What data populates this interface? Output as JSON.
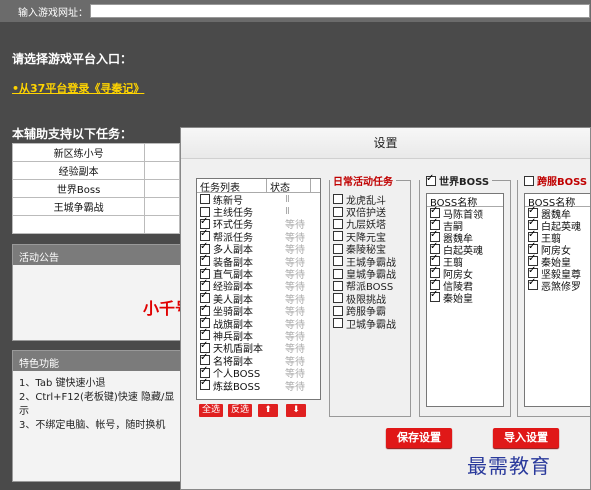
{
  "urlbar": {
    "label": "输入游戏网址：",
    "value": ""
  },
  "main": {
    "choose_title": "请选择游戏平台入口：",
    "platform_link": "•从37平台登录《寻秦记》",
    "support_title": "本辅助支持以下任务：",
    "support_rows": [
      "新区练小号",
      "经验副本",
      "世界Boss",
      "王城争霸战",
      ""
    ]
  },
  "notice": {
    "header": "活动公告",
    "red_text": "小千号"
  },
  "feature": {
    "header": "特色功能",
    "items": [
      "1、Tab 键快速小退",
      "2、Ctrl+F12(老板键)快速 隐藏/显示",
      "3、不绑定电脑、帐号，随时换机"
    ]
  },
  "dialog": {
    "title": "设置",
    "task_list": {
      "col_name": "任务列表",
      "col_status": "状态",
      "rows": [
        {
          "name": "练新号",
          "status": "Ⅱ",
          "checked": false
        },
        {
          "name": "主线任务",
          "status": "Ⅱ",
          "checked": false
        },
        {
          "name": "环式任务",
          "status": "等待",
          "checked": true
        },
        {
          "name": "帮派任务",
          "status": "等待",
          "checked": true
        },
        {
          "name": "多人副本",
          "status": "等待",
          "checked": true
        },
        {
          "name": "装备副本",
          "status": "等待",
          "checked": true
        },
        {
          "name": "直气副本",
          "status": "等待",
          "checked": true
        },
        {
          "name": "经验副本",
          "status": "等待",
          "checked": true
        },
        {
          "name": "美人副本",
          "status": "等待",
          "checked": true
        },
        {
          "name": "坐骑副本",
          "status": "等待",
          "checked": true
        },
        {
          "name": "战旗副本",
          "status": "等待",
          "checked": true
        },
        {
          "name": "神兵副本",
          "status": "等待",
          "checked": true
        },
        {
          "name": "天机盾副本",
          "status": "等待",
          "checked": true
        },
        {
          "name": "名将副本",
          "status": "等待",
          "checked": true
        },
        {
          "name": "个人BOSS",
          "status": "等待",
          "checked": true
        },
        {
          "name": "炼兹BOSS",
          "status": "等待",
          "checked": true
        }
      ]
    },
    "buttons": {
      "select_all": "全选",
      "invert": "反选",
      "up": "⬆",
      "down": "⬇",
      "save": "保存设置",
      "import": "导入设置"
    },
    "daily": {
      "title": "日常活动任务",
      "items": [
        "龙虎乱斗",
        "双倍护送",
        "九层妖塔",
        "天降元宝",
        "秦陵秘宝",
        "王城争霸战",
        "皇城争霸战",
        "帮派BOSS",
        "极限挑战",
        "跨服争霸",
        "卫城争霸战"
      ]
    },
    "world": {
      "title": "世界BOSS",
      "col": "BOSS名称",
      "items": [
        "马陈首领",
        "吉嗣",
        "嚣魏牟",
        "白起英魂",
        "王翦",
        "阿房女",
        "信陵君",
        "秦始皇"
      ]
    },
    "cross": {
      "title": "跨服BOSS",
      "col": "BOSS名称",
      "items": [
        "嚣魏牟",
        "白起英魂",
        "王翦",
        "阿房女",
        "秦始皇",
        "坚毅皇尊",
        "恶煞修罗"
      ]
    }
  },
  "watermark": "最需教育",
  "colors": {
    "accent_red": "#e01818",
    "panel_dark": "#4a4a4a",
    "link_yellow": "#ffd400"
  }
}
